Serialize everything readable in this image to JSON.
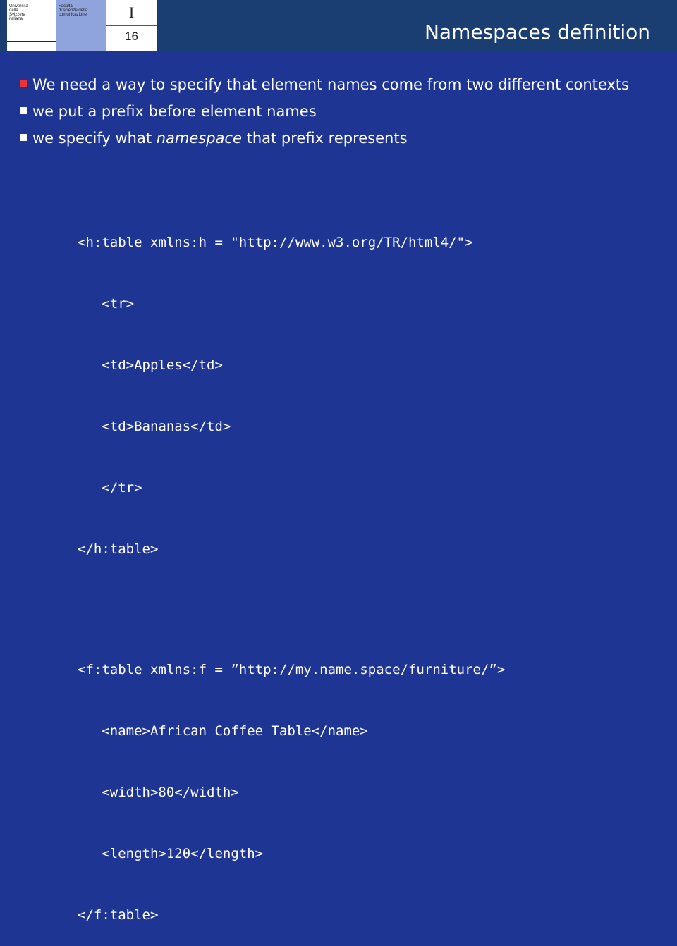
{
  "header": {
    "usi_logo_text": "Università\ndella\nSvizzera\nitaliana",
    "faculty_logo_text": "Facoltà\ndi scienze della\ncomunicazione",
    "section": "I",
    "slide_number": "16",
    "title": "Namespaces definition"
  },
  "bullets": [
    {
      "text_before": "We need a way to specify that element names come from two different contexts",
      "italic": "",
      "text_after": "",
      "marker_color": "#ee3333"
    },
    {
      "text_before": "we put a prefix before element names",
      "italic": "",
      "text_after": "",
      "marker_color": "#ffffff"
    },
    {
      "text_before": "we specify what ",
      "italic": "namespace",
      "text_after": " that prefix represents",
      "marker_color": "#ffffff"
    }
  ],
  "code_block_1": [
    "<h:table xmlns:h = \"http://www.w3.org/TR/html4/\">",
    "   <tr>",
    "   <td>Apples</td>",
    "   <td>Bananas</td>",
    "   </tr>",
    "</h:table>"
  ],
  "code_block_2": [
    "<f:table xmlns:f = ”http://my.name.space/furniture/”>",
    "   <name>African Coffee Table</name>",
    "   <width>80</width>",
    "   <length>120</length>",
    "</f:table>"
  ],
  "colors": {
    "background": "#1e3594",
    "header": "#1a3e72",
    "bullet_red": "#ee3333"
  }
}
